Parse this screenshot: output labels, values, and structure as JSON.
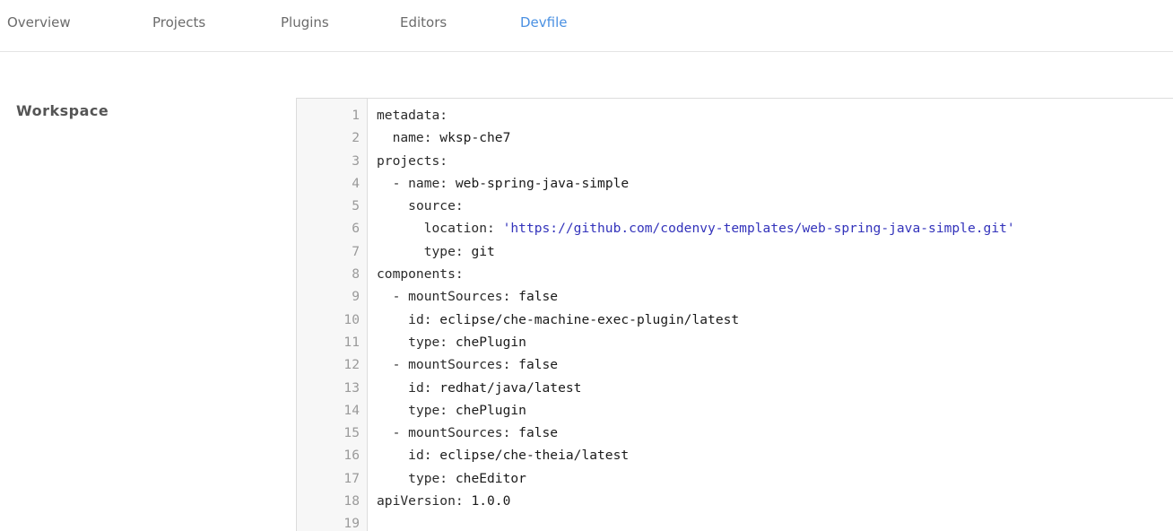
{
  "tabs": [
    {
      "label": "Overview",
      "active": false
    },
    {
      "label": "Projects",
      "active": false
    },
    {
      "label": "Plugins",
      "active": false
    },
    {
      "label": "Editors",
      "active": false
    },
    {
      "label": "Devfile",
      "active": true
    }
  ],
  "section": {
    "label": "Workspace"
  },
  "editor": {
    "lines": [
      {
        "num": "1",
        "indent": "",
        "key": "metadata:",
        "value": ""
      },
      {
        "num": "2",
        "indent": "  ",
        "key": "name:",
        "value": " wksp-che7"
      },
      {
        "num": "3",
        "indent": "",
        "key": "projects:",
        "value": ""
      },
      {
        "num": "4",
        "indent": "  ",
        "key": "- name:",
        "value": " web-spring-java-simple"
      },
      {
        "num": "5",
        "indent": "    ",
        "key": "source:",
        "value": ""
      },
      {
        "num": "6",
        "indent": "      ",
        "key": "location:",
        "string": " 'https://github.com/codenvy-templates/web-spring-java-simple.git'"
      },
      {
        "num": "7",
        "indent": "      ",
        "key": "type:",
        "value": " git"
      },
      {
        "num": "8",
        "indent": "",
        "key": "components:",
        "value": ""
      },
      {
        "num": "9",
        "indent": "  ",
        "key": "- mountSources:",
        "value": " false"
      },
      {
        "num": "10",
        "indent": "    ",
        "key": "id:",
        "value": " eclipse/che-machine-exec-plugin/latest"
      },
      {
        "num": "11",
        "indent": "    ",
        "key": "type:",
        "value": " chePlugin"
      },
      {
        "num": "12",
        "indent": "  ",
        "key": "- mountSources:",
        "value": " false"
      },
      {
        "num": "13",
        "indent": "    ",
        "key": "id:",
        "value": " redhat/java/latest"
      },
      {
        "num": "14",
        "indent": "    ",
        "key": "type:",
        "value": " chePlugin"
      },
      {
        "num": "15",
        "indent": "  ",
        "key": "- mountSources:",
        "value": " false"
      },
      {
        "num": "16",
        "indent": "    ",
        "key": "id:",
        "value": " eclipse/che-theia/latest"
      },
      {
        "num": "17",
        "indent": "    ",
        "key": "type:",
        "value": " cheEditor"
      },
      {
        "num": "18",
        "indent": "",
        "key": "apiVersion:",
        "value": " 1.0.0"
      },
      {
        "num": "19",
        "indent": "",
        "key": "",
        "value": ""
      }
    ]
  },
  "colors": {
    "active_tab": "#4a90e2",
    "inactive_tab": "#6b6b6b",
    "string": "#3333bb",
    "line_number": "#9a9a9a",
    "gutter_bg": "#f7f7f7"
  }
}
